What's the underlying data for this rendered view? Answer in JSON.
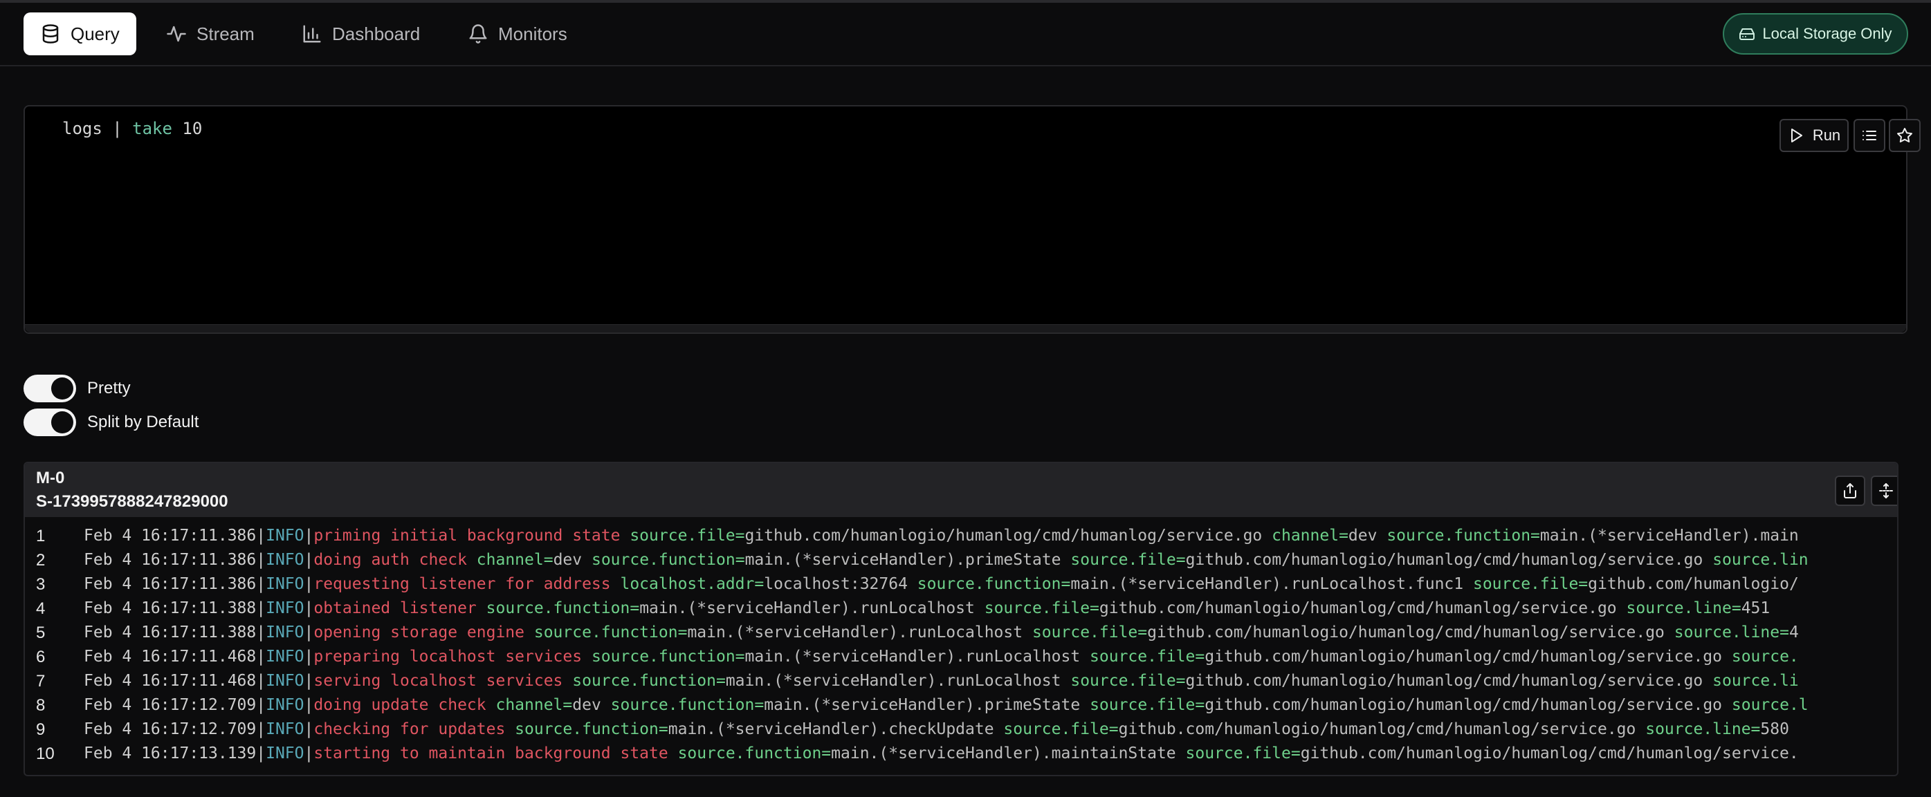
{
  "nav": {
    "tabs": [
      {
        "label": "Query",
        "icon": "database-icon",
        "active": true
      },
      {
        "label": "Stream",
        "icon": "activity-icon",
        "active": false
      },
      {
        "label": "Dashboard",
        "icon": "bar-chart-icon",
        "active": false
      },
      {
        "label": "Monitors",
        "icon": "bell-icon",
        "active": false
      }
    ],
    "storage_badge": "Local Storage Only"
  },
  "editor": {
    "query_pre": "logs | ",
    "query_kw": "take",
    "query_post": " 10",
    "run_label": "Run"
  },
  "toggles": {
    "pretty_label": "Pretty",
    "pretty_on": true,
    "split_label": "Split by Default",
    "split_on": true
  },
  "results": {
    "machine_id": "M-0",
    "session_id": "S-1739957888247829000",
    "colors": {
      "level": "#5aa9b8",
      "message": "#e05561",
      "key": "#6ed08a",
      "value": "#bdbdbd"
    },
    "rows": [
      {
        "n": "1",
        "time": "Feb 4 16:17:11.386",
        "level": "INFO",
        "msg": "priming initial background state",
        "kv": [
          [
            "source.file",
            "github.com/humanlogio/humanlog/cmd/humanlog/service.go"
          ],
          [
            "channel",
            "dev"
          ],
          [
            "source.function",
            "main.(*serviceHandler).main"
          ]
        ]
      },
      {
        "n": "2",
        "time": "Feb 4 16:17:11.386",
        "level": "INFO",
        "msg": "doing auth check",
        "kv": [
          [
            "channel",
            "dev"
          ],
          [
            "source.function",
            "main.(*serviceHandler).primeState"
          ],
          [
            "source.file",
            "github.com/humanlogio/humanlog/cmd/humanlog/service.go"
          ],
          [
            "source.lin",
            ""
          ]
        ]
      },
      {
        "n": "3",
        "time": "Feb 4 16:17:11.386",
        "level": "INFO",
        "msg": "requesting listener for address",
        "kv": [
          [
            "localhost.addr",
            "localhost:32764"
          ],
          [
            "source.function",
            "main.(*serviceHandler).runLocalhost.func1"
          ],
          [
            "source.file",
            "github.com/humanlogio/"
          ]
        ]
      },
      {
        "n": "4",
        "time": "Feb 4 16:17:11.388",
        "level": "INFO",
        "msg": "obtained listener",
        "kv": [
          [
            "source.function",
            "main.(*serviceHandler).runLocalhost"
          ],
          [
            "source.file",
            "github.com/humanlogio/humanlog/cmd/humanlog/service.go"
          ],
          [
            "source.line",
            "451"
          ]
        ]
      },
      {
        "n": "5",
        "time": "Feb 4 16:17:11.388",
        "level": "INFO",
        "msg": "opening storage engine",
        "kv": [
          [
            "source.function",
            "main.(*serviceHandler).runLocalhost"
          ],
          [
            "source.file",
            "github.com/humanlogio/humanlog/cmd/humanlog/service.go"
          ],
          [
            "source.line",
            "4"
          ]
        ]
      },
      {
        "n": "6",
        "time": "Feb 4 16:17:11.468",
        "level": "INFO",
        "msg": "preparing localhost services",
        "kv": [
          [
            "source.function",
            "main.(*serviceHandler).runLocalhost"
          ],
          [
            "source.file",
            "github.com/humanlogio/humanlog/cmd/humanlog/service.go"
          ],
          [
            "source.",
            ""
          ]
        ]
      },
      {
        "n": "7",
        "time": "Feb 4 16:17:11.468",
        "level": "INFO",
        "msg": "serving localhost services",
        "kv": [
          [
            "source.function",
            "main.(*serviceHandler).runLocalhost"
          ],
          [
            "source.file",
            "github.com/humanlogio/humanlog/cmd/humanlog/service.go"
          ],
          [
            "source.li",
            ""
          ]
        ]
      },
      {
        "n": "8",
        "time": "Feb 4 16:17:12.709",
        "level": "INFO",
        "msg": "doing update check",
        "kv": [
          [
            "channel",
            "dev"
          ],
          [
            "source.function",
            "main.(*serviceHandler).primeState"
          ],
          [
            "source.file",
            "github.com/humanlogio/humanlog/cmd/humanlog/service.go"
          ],
          [
            "source.l",
            ""
          ]
        ]
      },
      {
        "n": "9",
        "time": "Feb 4 16:17:12.709",
        "level": "INFO",
        "msg": "checking for updates",
        "kv": [
          [
            "source.function",
            "main.(*serviceHandler).checkUpdate"
          ],
          [
            "source.file",
            "github.com/humanlogio/humanlog/cmd/humanlog/service.go"
          ],
          [
            "source.line",
            "580"
          ]
        ]
      },
      {
        "n": "10",
        "time": "Feb 4 16:17:13.139",
        "level": "INFO",
        "msg": "starting to maintain background state",
        "kv": [
          [
            "source.function",
            "main.(*serviceHandler).maintainState"
          ],
          [
            "source.file",
            "github.com/humanlogio/humanlog/cmd/humanlog/service."
          ]
        ]
      }
    ]
  }
}
